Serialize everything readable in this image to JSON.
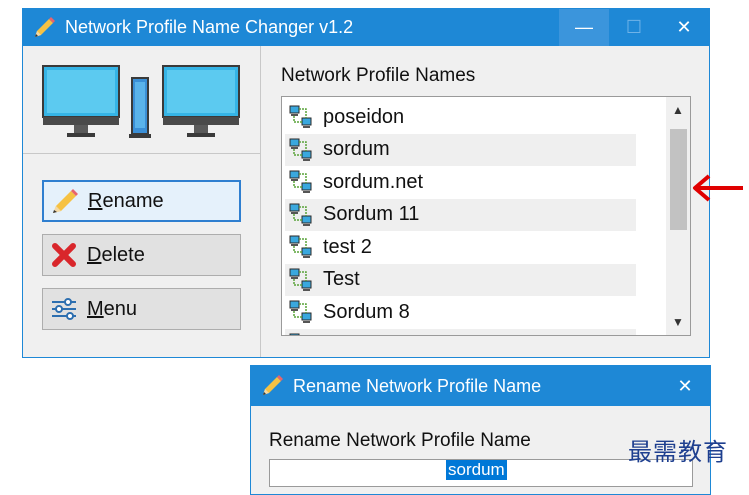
{
  "main_window": {
    "title": "Network Profile Name Changer v1.2",
    "controls": {
      "minimize": "—",
      "maximize": "☐",
      "close": "✕"
    }
  },
  "buttons": {
    "rename": {
      "underline": "R",
      "rest": "ename"
    },
    "delete": {
      "underline": "D",
      "rest": "elete"
    },
    "menu": {
      "underline": "M",
      "rest": "enu"
    }
  },
  "profile_list": {
    "label": "Network Profile Names",
    "items": [
      {
        "name": "poseidon"
      },
      {
        "name": "sordum"
      },
      {
        "name": "sordum.net"
      },
      {
        "name": "Sordum 11"
      },
      {
        "name": "test 2"
      },
      {
        "name": "Test"
      },
      {
        "name": "Sordum 8"
      }
    ]
  },
  "rename_dialog": {
    "title": "Rename Network Profile Name",
    "label": "Rename Network Profile Name",
    "input_value": "sordum",
    "close": "✕"
  },
  "watermark": "最需教育",
  "colors": {
    "titlebar": "#1e88d6",
    "selection": "#0078d7",
    "arrow": "#e00000"
  },
  "icons": {
    "app": "pencil-icon",
    "logo": "two-computers-icon",
    "rename": "pencil-icon",
    "delete": "red-x-icon",
    "menu": "sliders-icon",
    "row": "network-icon"
  }
}
